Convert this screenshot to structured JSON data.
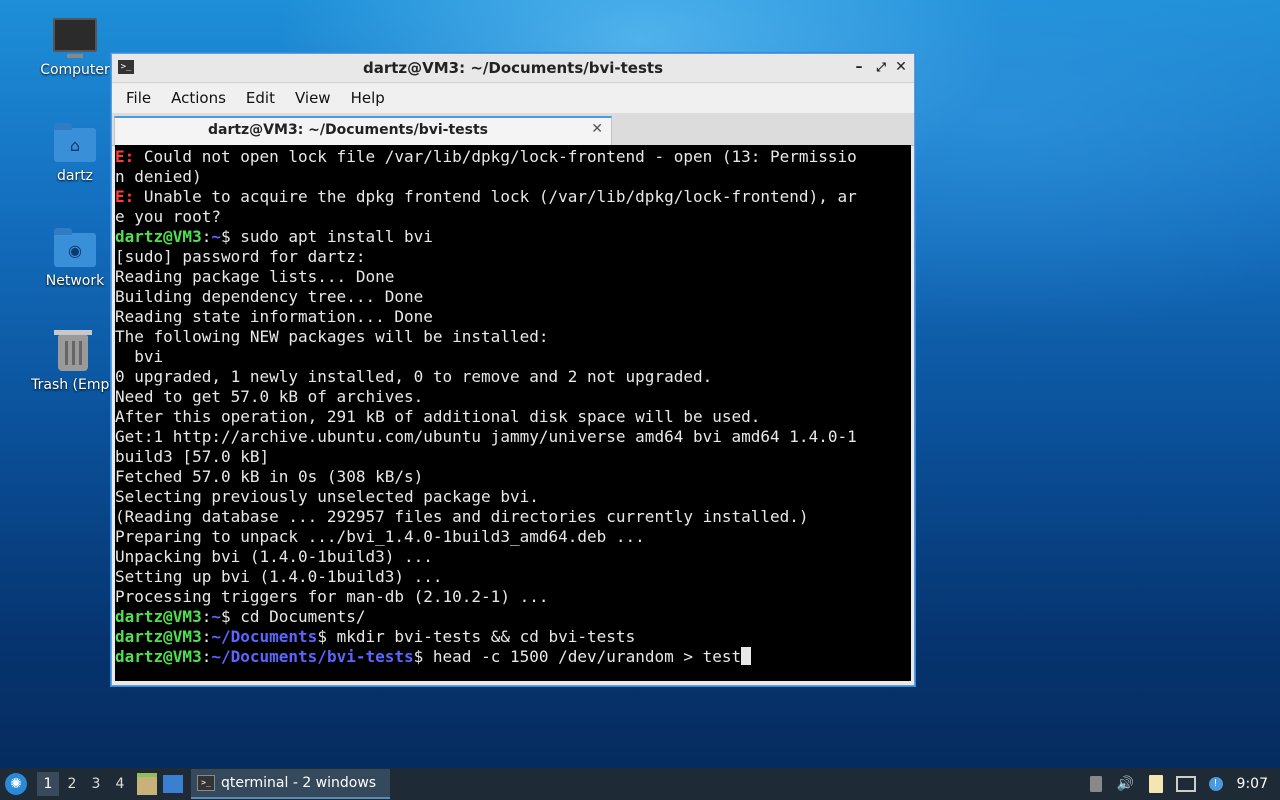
{
  "desktop": {
    "icons": [
      {
        "label": "Computer",
        "icon": "computer-icon"
      },
      {
        "label": "dartz",
        "icon": "home-folder-icon"
      },
      {
        "label": "Network",
        "icon": "network-folder-icon"
      },
      {
        "label": "Trash (Empt",
        "icon": "trash-icon"
      }
    ]
  },
  "window": {
    "title": "dartz@VM3: ~/Documents/bvi-tests",
    "controls": {
      "minimize": "–",
      "maximize": "⤢",
      "close": "✕"
    },
    "menu": [
      "File",
      "Actions",
      "Edit",
      "View",
      "Help"
    ],
    "tab": {
      "label": "dartz@VM3: ~/Documents/bvi-tests",
      "close": "✕"
    }
  },
  "terminal": {
    "lines": [
      {
        "parts": [
          {
            "t": "E:",
            "c": "err"
          },
          {
            "t": " Could not open lock file /var/lib/dpkg/lock-frontend - open (13: Permissio"
          }
        ]
      },
      {
        "parts": [
          {
            "t": "n denied)"
          }
        ]
      },
      {
        "parts": [
          {
            "t": "E:",
            "c": "err"
          },
          {
            "t": " Unable to acquire the dpkg frontend lock (/var/lib/dpkg/lock-frontend), ar"
          }
        ]
      },
      {
        "parts": [
          {
            "t": "e you root?"
          }
        ]
      },
      {
        "parts": [
          {
            "t": "dartz@VM3",
            "c": "user"
          },
          {
            "t": ":"
          },
          {
            "t": "~",
            "c": "path"
          },
          {
            "t": "$ sudo apt install bvi"
          }
        ]
      },
      {
        "parts": [
          {
            "t": "[sudo] password for dartz:"
          }
        ]
      },
      {
        "parts": [
          {
            "t": "Reading package lists... Done"
          }
        ]
      },
      {
        "parts": [
          {
            "t": "Building dependency tree... Done"
          }
        ]
      },
      {
        "parts": [
          {
            "t": "Reading state information... Done"
          }
        ]
      },
      {
        "parts": [
          {
            "t": "The following NEW packages will be installed:"
          }
        ]
      },
      {
        "parts": [
          {
            "t": "  bvi"
          }
        ]
      },
      {
        "parts": [
          {
            "t": "0 upgraded, 1 newly installed, 0 to remove and 2 not upgraded."
          }
        ]
      },
      {
        "parts": [
          {
            "t": "Need to get 57.0 kB of archives."
          }
        ]
      },
      {
        "parts": [
          {
            "t": "After this operation, 291 kB of additional disk space will be used."
          }
        ]
      },
      {
        "parts": [
          {
            "t": "Get:1 http://archive.ubuntu.com/ubuntu jammy/universe amd64 bvi amd64 1.4.0-1"
          }
        ]
      },
      {
        "parts": [
          {
            "t": "build3 [57.0 kB]"
          }
        ]
      },
      {
        "parts": [
          {
            "t": "Fetched 57.0 kB in 0s (308 kB/s)"
          }
        ]
      },
      {
        "parts": [
          {
            "t": "Selecting previously unselected package bvi."
          }
        ]
      },
      {
        "parts": [
          {
            "t": "(Reading database ... 292957 files and directories currently installed.)"
          }
        ]
      },
      {
        "parts": [
          {
            "t": "Preparing to unpack .../bvi_1.4.0-1build3_amd64.deb ..."
          }
        ]
      },
      {
        "parts": [
          {
            "t": "Unpacking bvi (1.4.0-1build3) ..."
          }
        ]
      },
      {
        "parts": [
          {
            "t": "Setting up bvi (1.4.0-1build3) ..."
          }
        ]
      },
      {
        "parts": [
          {
            "t": "Processing triggers for man-db (2.10.2-1) ..."
          }
        ]
      },
      {
        "parts": [
          {
            "t": "dartz@VM3",
            "c": "user"
          },
          {
            "t": ":"
          },
          {
            "t": "~",
            "c": "path"
          },
          {
            "t": "$ cd Documents/"
          }
        ]
      },
      {
        "parts": [
          {
            "t": "dartz@VM3",
            "c": "user"
          },
          {
            "t": ":"
          },
          {
            "t": "~/Documents",
            "c": "path"
          },
          {
            "t": "$ mkdir bvi-tests && cd bvi-tests"
          }
        ]
      },
      {
        "parts": [
          {
            "t": "dartz@VM3",
            "c": "user"
          },
          {
            "t": ":"
          },
          {
            "t": "~/Documents/bvi-tests",
            "c": "path"
          },
          {
            "t": "$ head -c 1500 /dev/urandom > test"
          }
        ],
        "cursor": true
      }
    ]
  },
  "taskbar": {
    "start_icon": "start-menu-icon",
    "workspaces": [
      "1",
      "2",
      "3",
      "4"
    ],
    "active_workspace": "1",
    "task_label": "qterminal - 2 windows",
    "tray_icons": [
      "clipboard-icon",
      "volume-icon",
      "file-manager-icon",
      "network-icon",
      "notification-icon"
    ],
    "clock": "9:07"
  },
  "colors": {
    "error": "#ff3b3b",
    "user": "#4fe04f",
    "path": "#5a66ff",
    "accent": "#4a9ae0"
  }
}
